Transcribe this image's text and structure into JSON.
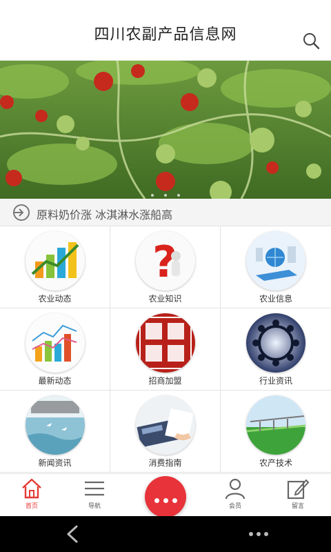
{
  "header": {
    "title": "四川农副产品信息网"
  },
  "banner": {
    "dots": 3,
    "active_dot": 0
  },
  "ticker": {
    "text": "原料奶价涨 冰淇淋水涨船高"
  },
  "grid": {
    "items": [
      {
        "label": "农业动态",
        "icon": "bar-chart-icon"
      },
      {
        "label": "农业知识",
        "icon": "question-mark-icon"
      },
      {
        "label": "农业信息",
        "icon": "globe-laptop-icon"
      },
      {
        "label": "最新动态",
        "icon": "line-chart-icon"
      },
      {
        "label": "招商加盟",
        "icon": "franchise-stamp-icon"
      },
      {
        "label": "行业资讯",
        "icon": "people-circle-icon"
      },
      {
        "label": "新闻资讯",
        "icon": "news-icon"
      },
      {
        "label": "消费指南",
        "icon": "calculator-icon"
      },
      {
        "label": "农产技术",
        "icon": "irrigation-field-icon"
      }
    ]
  },
  "tabbar": {
    "items": [
      {
        "label": "首页",
        "icon": "home-icon",
        "active": true
      },
      {
        "label": "导航",
        "icon": "menu-icon"
      },
      {
        "label": "会员",
        "icon": "user-icon"
      },
      {
        "label": "留言",
        "icon": "edit-icon"
      }
    ],
    "fab_icon": "more-dots-icon"
  },
  "colors": {
    "accent": "#e8333a",
    "active_tab": "#e53a34"
  }
}
